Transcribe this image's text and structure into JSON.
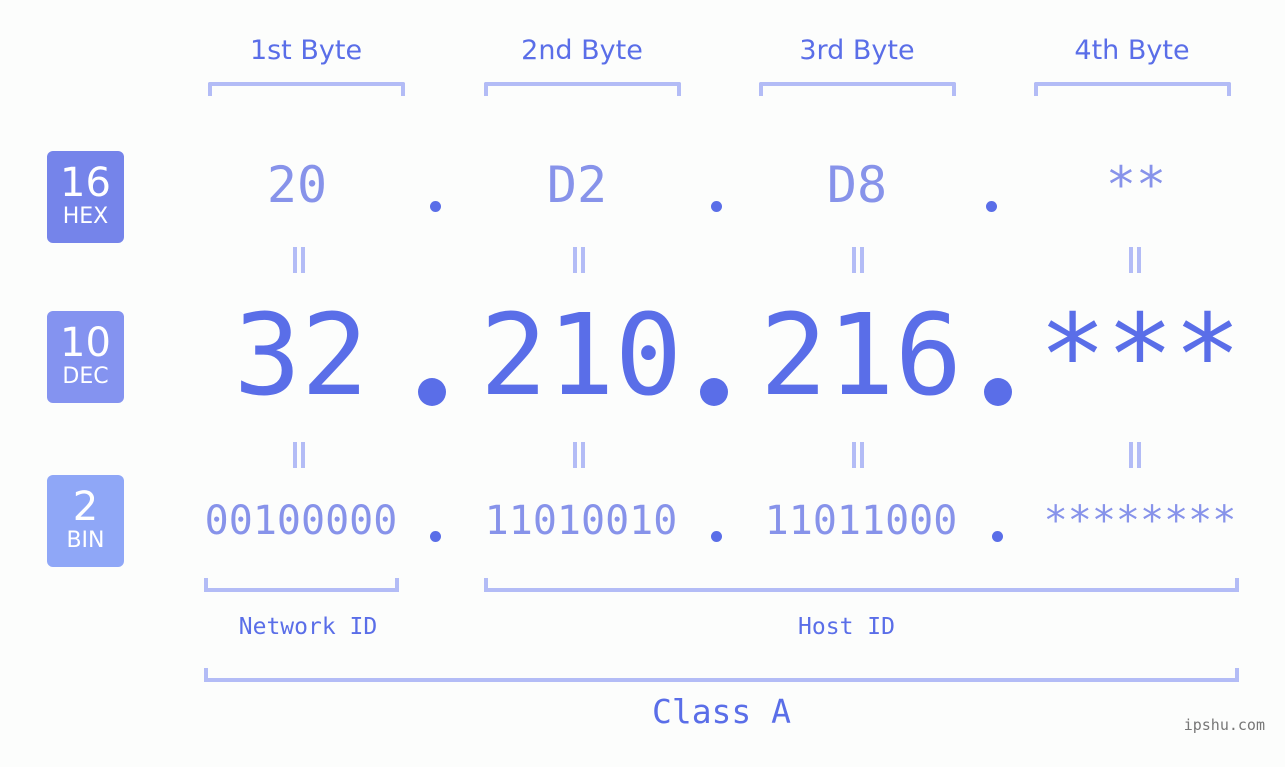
{
  "byte_headers": [
    "1st Byte",
    "2nd Byte",
    "3rd Byte",
    "4th Byte"
  ],
  "badges": {
    "hex": {
      "num": "16",
      "label": "HEX",
      "color": "#7584ea"
    },
    "dec": {
      "num": "10",
      "label": "DEC",
      "color": "#8493f0"
    },
    "bin": {
      "num": "2",
      "label": "BIN",
      "color": "#8fa7f7"
    }
  },
  "hex": [
    "20",
    "D2",
    "D8",
    "**"
  ],
  "dec": [
    "32",
    "210",
    "216",
    "***"
  ],
  "bin": [
    "00100000",
    "11010010",
    "11011000",
    "********"
  ],
  "separator": ".",
  "labels": {
    "network_id": "Network ID",
    "host_id": "Host ID",
    "class": "Class A"
  },
  "watermark": "ipshu.com",
  "colors": {
    "accent": "#5a6ee8",
    "light": "#8793ea",
    "bracket": "#b3bcf6"
  }
}
